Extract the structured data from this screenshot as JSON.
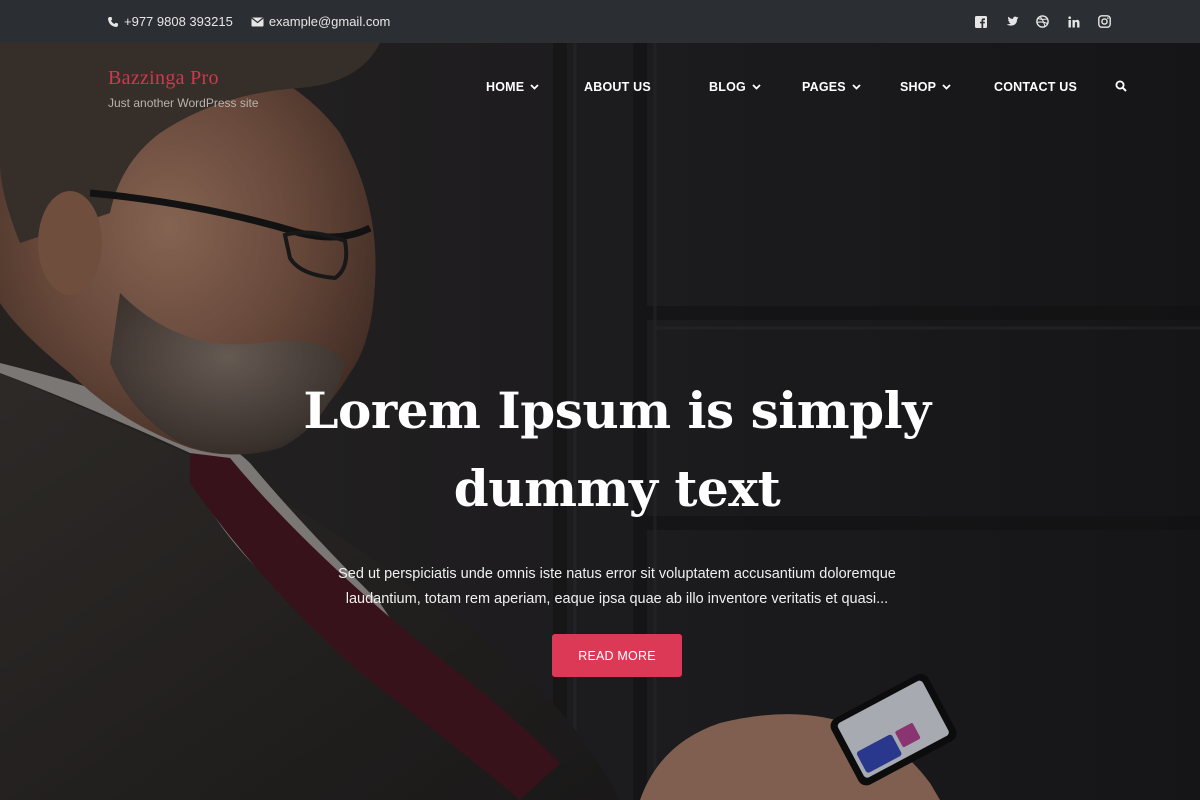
{
  "topbar": {
    "phone": "+977 9808 393215",
    "email": "example@gmail.com",
    "social_icons": [
      "facebook-icon",
      "twitter-icon",
      "dribbble-icon",
      "linkedin-icon",
      "instagram-icon"
    ]
  },
  "brand": {
    "title": "Bazzinga Pro",
    "tagline": "Just another WordPress site"
  },
  "nav": {
    "items": [
      {
        "label": "HOME",
        "has_dropdown": true
      },
      {
        "label": "ABOUT US",
        "has_dropdown": false
      },
      {
        "label": "BLOG",
        "has_dropdown": true
      },
      {
        "label": "PAGES",
        "has_dropdown": true
      },
      {
        "label": "SHOP",
        "has_dropdown": true
      },
      {
        "label": "CONTACT US",
        "has_dropdown": false
      }
    ],
    "search_icon": "search-icon"
  },
  "hero": {
    "headline_line1": "Lorem Ipsum is simply",
    "headline_line2": "dummy text",
    "subtext_line1": "Sed ut perspiciatis unde omnis iste natus error sit voluptatem accusantium doloremque",
    "subtext_line2": "laudantium, totam rem aperiam, eaque ipsa quae ab illo inventore veritatis et quasi...",
    "cta_label": "READ MORE"
  },
  "colors": {
    "topbar_bg": "#2b2e33",
    "accent": "#dc3956",
    "brand": "#d0384f"
  }
}
